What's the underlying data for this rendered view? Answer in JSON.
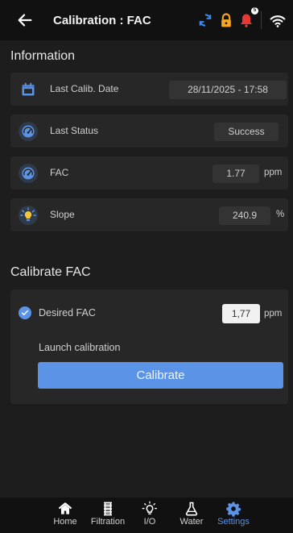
{
  "header": {
    "title": "Calibration : FAC",
    "notification_count": "5",
    "icons": [
      "back-arrow-icon",
      "sync-icon",
      "lock-icon",
      "bell-icon",
      "wifi-icon"
    ]
  },
  "information": {
    "section_title": "Information",
    "rows": [
      {
        "icon": "calendar-icon",
        "label": "Last Calib. Date",
        "value": "28/11/2025 - 17:58",
        "unit": ""
      },
      {
        "icon": "gauge-icon",
        "label": "Last Status",
        "value": "Success",
        "unit": ""
      },
      {
        "icon": "gauge-icon",
        "label": "FAC",
        "value": "1.77",
        "unit": "ppm"
      },
      {
        "icon": "sun-icon",
        "label": "Slope",
        "value": "240.9",
        "unit": "%"
      }
    ]
  },
  "calibrate": {
    "section_title": "Calibrate FAC",
    "desired_label": "Desired FAC",
    "desired_value": "1,77",
    "desired_unit": "ppm",
    "launch_label": "Launch calibration",
    "button_label": "Calibrate"
  },
  "nav": {
    "items": [
      {
        "label": "Home",
        "icon": "home-icon"
      },
      {
        "label": "Filtration",
        "icon": "filter-icon"
      },
      {
        "label": "I/O",
        "icon": "lightbulb-icon"
      },
      {
        "label": "Water",
        "icon": "flask-icon"
      },
      {
        "label": "Settings",
        "icon": "gear-icon"
      }
    ],
    "active": "Settings"
  },
  "colors": {
    "accent": "#5b93e6",
    "sync": "#3d8bf0",
    "lock": "#f5a623",
    "bell": "#e53935",
    "icon_yellow": "#f2c53d"
  }
}
